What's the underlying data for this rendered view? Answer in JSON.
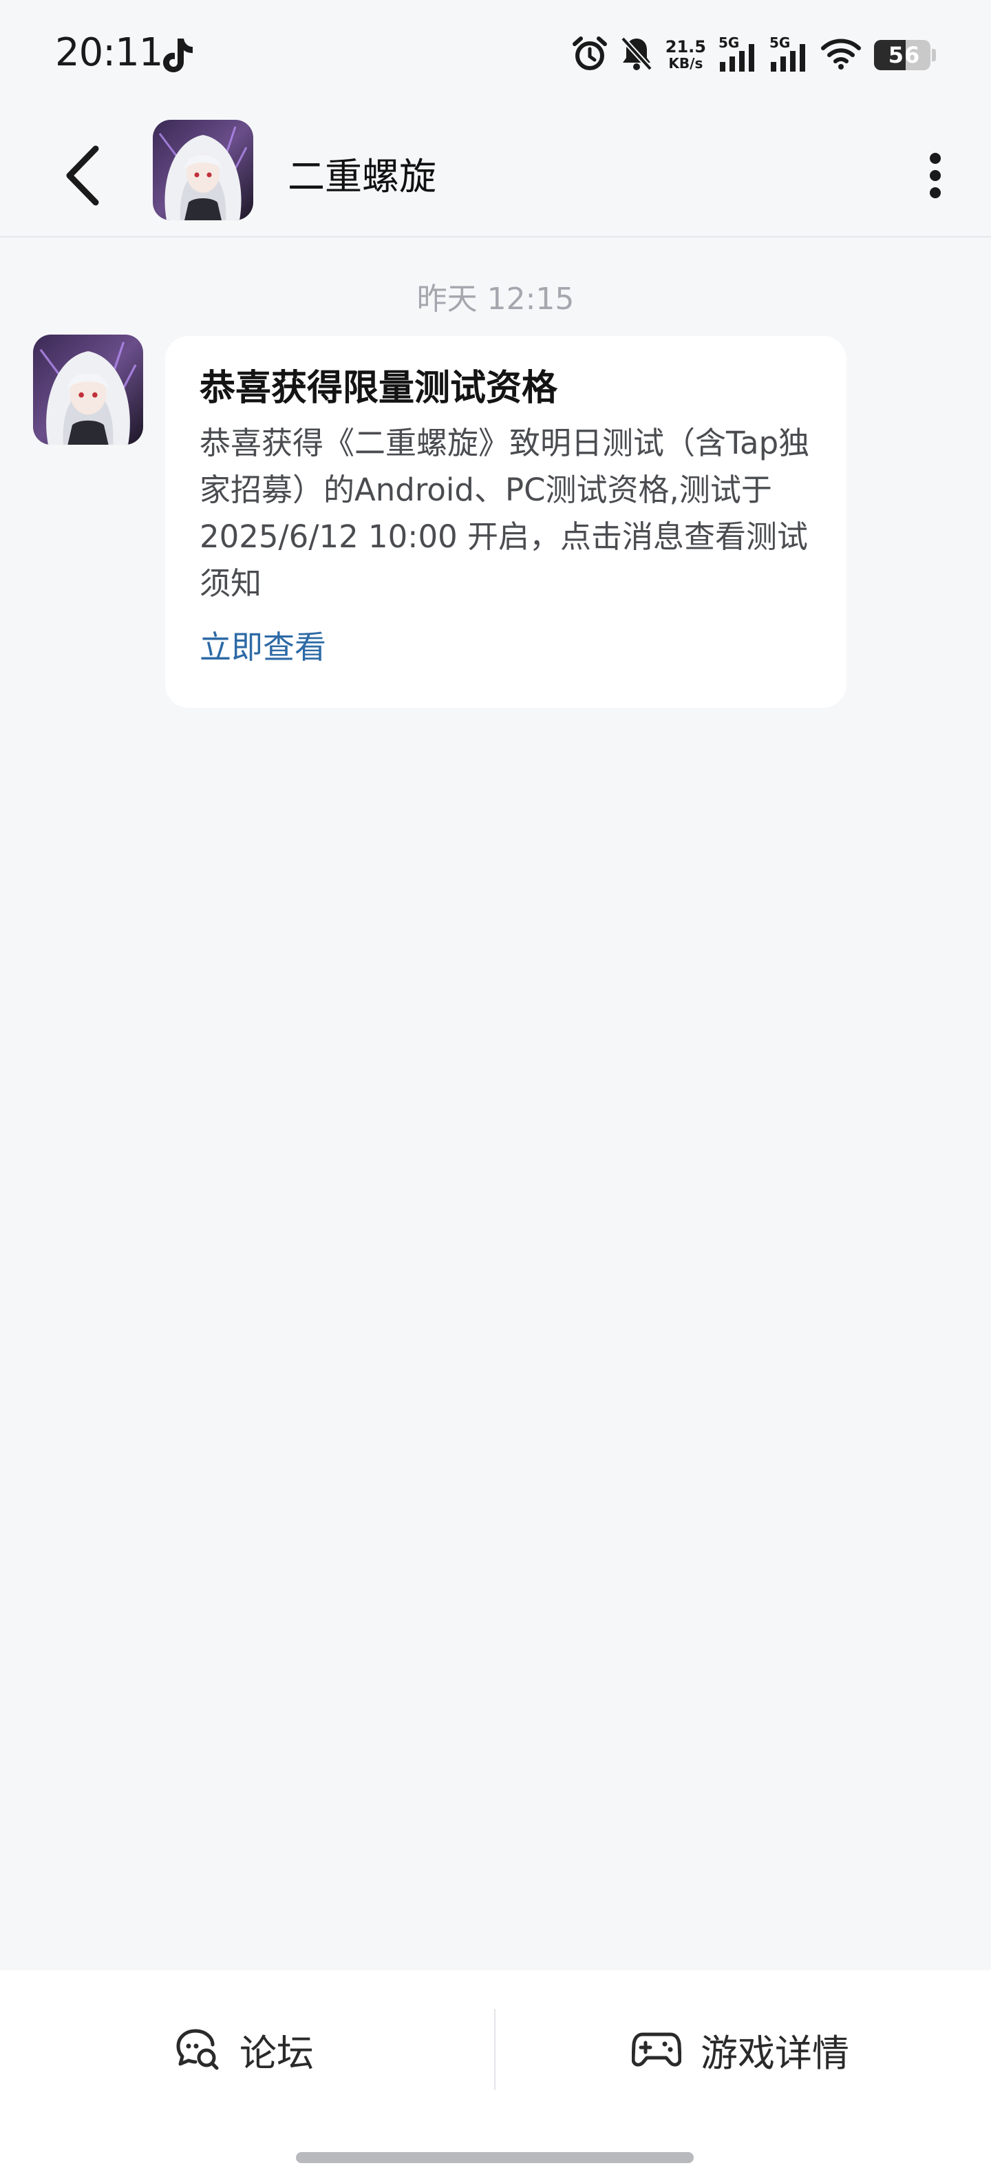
{
  "status_bar": {
    "time": "20:11",
    "net_speed_value": "21.5",
    "net_speed_unit": "KB/s",
    "sim1_label": "5G",
    "sim2_label": "5G",
    "battery_level": "56",
    "icons": [
      "tiktok-icon",
      "alarm-icon",
      "mute-bell-icon",
      "signal-icon",
      "signal-icon",
      "wifi-icon",
      "battery-icon"
    ]
  },
  "header": {
    "title": "二重螺旋",
    "back_icon": "back-chevron-icon",
    "more_icon": "more-vertical-icon"
  },
  "conversation": {
    "timestamp": "昨天  12:15",
    "messages": [
      {
        "title": "恭喜获得限量测试资格",
        "body": "恭喜获得《二重螺旋》致明日测试（含Tap独家招募）的Android、PC测试资格,测试于2025/6/12 10:00 开启，点击消息查看测试须知",
        "link": "立即查看"
      }
    ]
  },
  "bottom_bar": {
    "forum_label": "论坛",
    "game_detail_label": "游戏详情"
  },
  "colors": {
    "background": "#f6f7f9",
    "card": "#ffffff",
    "link": "#2d6aa6",
    "timestamp": "#a4a7ad"
  }
}
